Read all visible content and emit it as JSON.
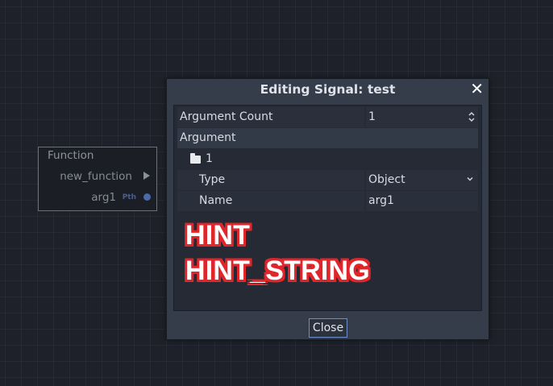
{
  "node": {
    "title": "Function",
    "output_label": "new_function",
    "arg_label": "arg1",
    "arg_type": "Pth"
  },
  "dialog": {
    "title": "Editing Signal: test",
    "close_icon": "close-icon",
    "close_label": "Close",
    "rows": {
      "argument_count": {
        "label": "Argument Count",
        "value": "1"
      },
      "argument_section": "Argument",
      "group": "1",
      "type": {
        "label": "Type",
        "value": "Object"
      },
      "name": {
        "label": "Name",
        "value": "arg1"
      }
    },
    "overlay_text": [
      "HINT",
      "HINT_STRING"
    ]
  },
  "colors": {
    "accent": "#6f8ec7",
    "overlay_stroke": "#e0262b",
    "port": "#4b6aa8"
  }
}
